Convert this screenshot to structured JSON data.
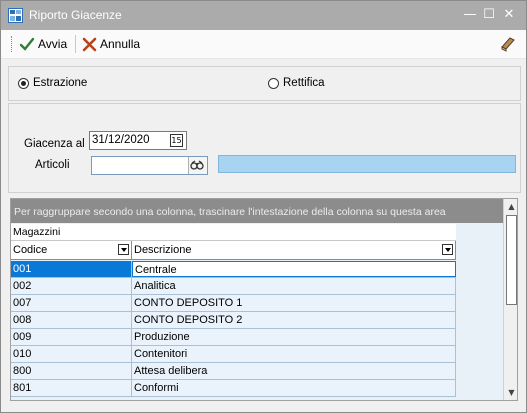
{
  "window": {
    "title": "Riporto Giacenze",
    "minimize_glyph": "—",
    "maximize_glyph": "☐",
    "close_glyph": "✕"
  },
  "toolbar": {
    "run_label": "Avvia",
    "cancel_label": "Annulla",
    "run_icon": "check-icon",
    "cancel_icon": "x-icon",
    "book_icon": "book-icon"
  },
  "mode": {
    "options": [
      "Estrazione",
      "Rettifica"
    ],
    "selected": "Estrazione"
  },
  "filters": {
    "giacenza_label": "Giacenza al",
    "giacenza_value": "31/12/2020",
    "calendar_glyph": "15",
    "articoli_label": "Articoli",
    "articoli_value": "",
    "articoli_description": ""
  },
  "grid": {
    "group_hint": "Per raggruppare secondo una colonna, trascinare l'intestazione della colonna su questa area",
    "band_title": "Magazzini",
    "columns": [
      "Codice",
      "Descrizione"
    ],
    "selected_row": 0,
    "rows": [
      {
        "codice": "001",
        "descrizione": "Centrale"
      },
      {
        "codice": "002",
        "descrizione": "Analitica"
      },
      {
        "codice": "007",
        "descrizione": "CONTO DEPOSITO 1"
      },
      {
        "codice": "008",
        "descrizione": "CONTO DEPOSITO 2"
      },
      {
        "codice": "009",
        "descrizione": "Produzione"
      },
      {
        "codice": "010",
        "descrizione": "Contenitori"
      },
      {
        "codice": "800",
        "descrizione": "Attesa delibera"
      },
      {
        "codice": "801",
        "descrizione": "Conformi"
      }
    ]
  },
  "colors": {
    "selection": "#0a78d7",
    "row_bg": "#eaf3fb",
    "group_bar": "#8c8c8c",
    "description_fill": "#a8d4f2"
  }
}
